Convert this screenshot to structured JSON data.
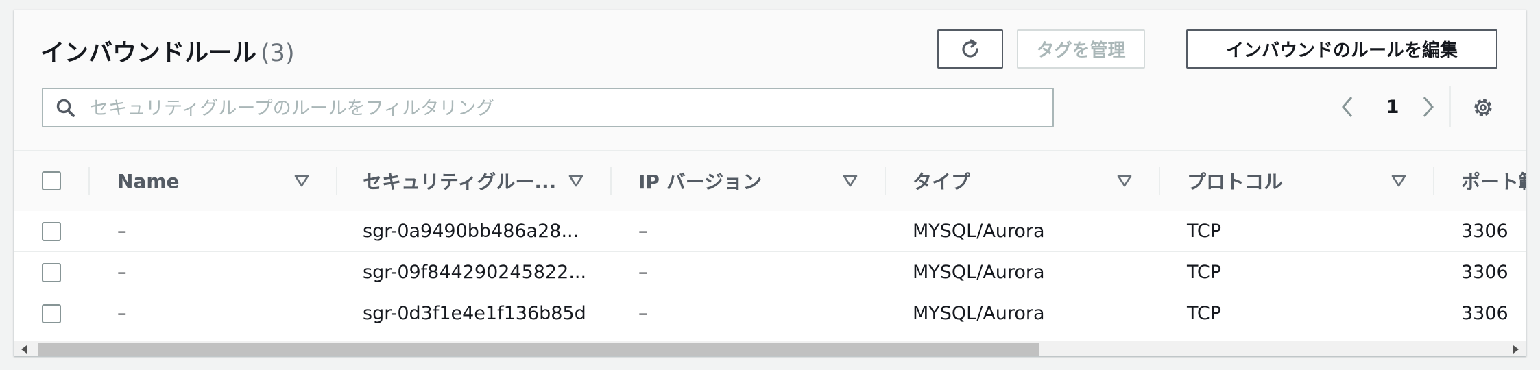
{
  "header": {
    "title": "インバウンドルール",
    "count": "(3)",
    "refresh_icon": "refresh-icon",
    "manage_tags_label": "タグを管理",
    "edit_rules_label": "インバウンドのルールを編集"
  },
  "search": {
    "placeholder": "セキュリティグループのルールをフィルタリング",
    "value": ""
  },
  "pagination": {
    "current_page": "1"
  },
  "table": {
    "columns": [
      {
        "label": "Name"
      },
      {
        "label": "セキュリティグルー..."
      },
      {
        "label": "IP バージョン"
      },
      {
        "label": "タイプ"
      },
      {
        "label": "プロトコル"
      },
      {
        "label": "ポート範"
      }
    ],
    "rows": [
      {
        "name": "–",
        "sgr_id": "sgr-0a9490bb486a28...",
        "ip_version": "–",
        "type": "MYSQL/Aurora",
        "protocol": "TCP",
        "port": "3306"
      },
      {
        "name": "–",
        "sgr_id": "sgr-09f844290245822...",
        "ip_version": "–",
        "type": "MYSQL/Aurora",
        "protocol": "TCP",
        "port": "3306"
      },
      {
        "name": "–",
        "sgr_id": "sgr-0d3f1e4e1f136b85d",
        "ip_version": "–",
        "type": "MYSQL/Aurora",
        "protocol": "TCP",
        "port": "3306"
      }
    ]
  },
  "colors": {
    "text_primary": "#16191f",
    "text_secondary": "#545b64",
    "disabled": "#aab7b8",
    "border": "#eaeded"
  }
}
